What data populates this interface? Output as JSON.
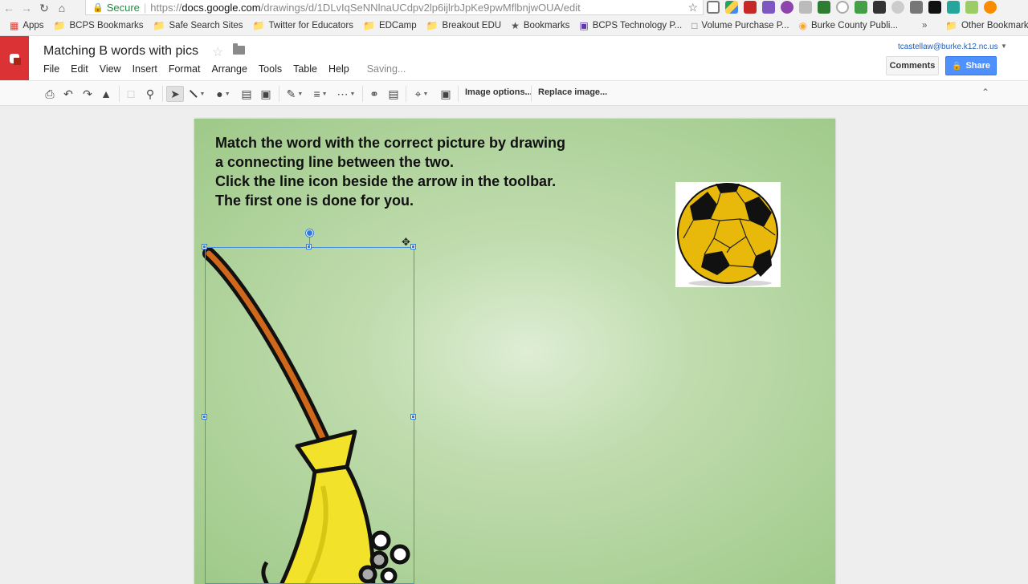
{
  "browser": {
    "secure_label": "Secure",
    "url_scheme": "https://",
    "url_host": "docs.google.com",
    "url_path": "/drawings/d/1DLvIqSeNNlnaUCdpv2lp6ijlrbJpKe9pwMflbnjwOUA/edit",
    "bookmarks": [
      {
        "label": "Apps",
        "icon": "apps-grid-icon"
      },
      {
        "label": "BCPS Bookmarks",
        "icon": "folder-icon"
      },
      {
        "label": "Safe Search Sites",
        "icon": "folder-icon"
      },
      {
        "label": "Twitter for Educators",
        "icon": "folder-icon"
      },
      {
        "label": "EDCamp",
        "icon": "folder-icon"
      },
      {
        "label": "Breakout EDU",
        "icon": "folder-icon"
      },
      {
        "label": "Bookmarks",
        "icon": "star-icon"
      },
      {
        "label": "BCPS Technology P...",
        "icon": "bookmark-icon"
      },
      {
        "label": "Volume Purchase P...",
        "icon": "page-icon"
      },
      {
        "label": "Burke County Publi...",
        "icon": "site-icon"
      }
    ],
    "more_label": "»",
    "other_bookmarks": "Other Bookmarks"
  },
  "doc": {
    "title": "Matching B words with pics",
    "menus": [
      "File",
      "Edit",
      "View",
      "Insert",
      "Format",
      "Arrange",
      "Tools",
      "Table",
      "Help"
    ],
    "status": "Saving...",
    "user_email": "tcastellaw@burke.k12.nc.us",
    "comments_label": "Comments",
    "share_label": "Share"
  },
  "toolbar": {
    "image_options": "Image options...",
    "replace_image": "Replace image..."
  },
  "slide": {
    "instructions": [
      "Match the word with the correct picture by drawing",
      "a connecting line between the two.",
      "Click the line icon beside the arrow in the toolbar.",
      "The first one is done for you."
    ]
  },
  "colors": {
    "logo_red": "#db3236",
    "share_blue": "#4d90fe",
    "selection_blue": "#4a90e2",
    "slide_green": "#9ec989",
    "ball_yellow": "#e8b90a",
    "broom_yellow": "#f2e22a",
    "broom_handle": "#d0681c"
  }
}
